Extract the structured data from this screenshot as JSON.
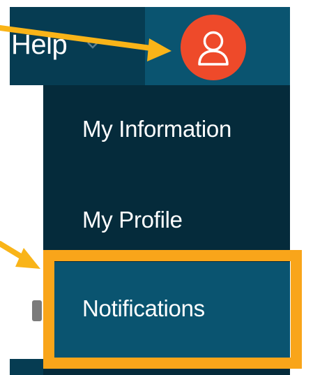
{
  "header": {
    "help_label": "Help",
    "help_chevron_icon": "chevron-down-icon",
    "user_icon": "user-icon",
    "avatar_color": "#ee4a2a",
    "header_color": "#063c52",
    "active_tile_color": "#0a5470"
  },
  "user_menu": {
    "items": [
      {
        "label": "My Information",
        "selected": false
      },
      {
        "label": "My Profile",
        "selected": false
      },
      {
        "label": "Notifications",
        "selected": true
      }
    ],
    "menu_color": "#052b3b"
  },
  "annotations": {
    "highlight_color": "#f9a51a",
    "arrow_color": "#f9b418"
  }
}
